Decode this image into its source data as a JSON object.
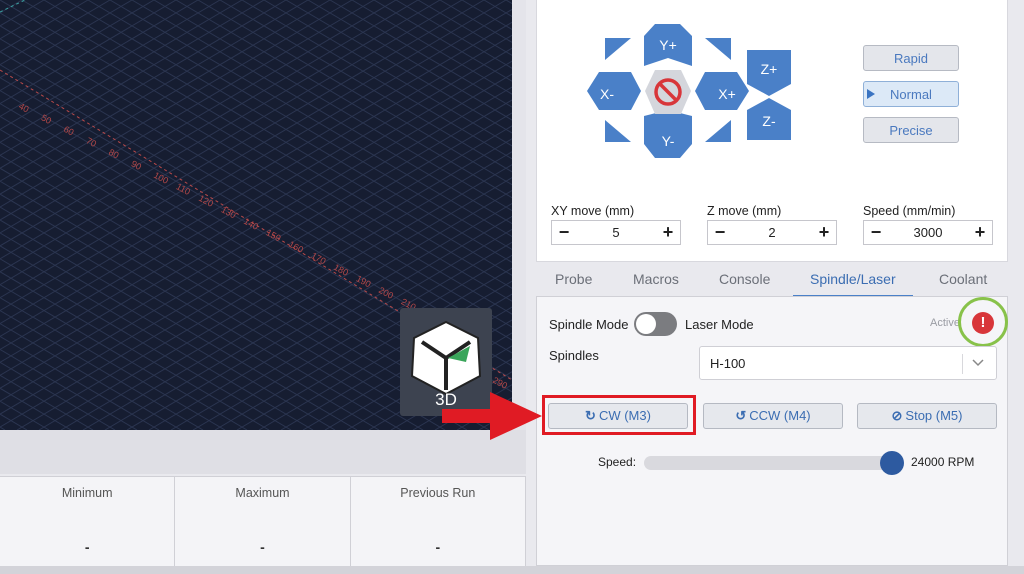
{
  "viewport": {
    "axis_ticks": [
      "40",
      "50",
      "60",
      "70",
      "80",
      "90",
      "100",
      "110",
      "120",
      "130",
      "140",
      "150",
      "160",
      "170",
      "180",
      "190",
      "200",
      "210",
      "290"
    ],
    "view_button_label": "3D"
  },
  "stats": {
    "columns": [
      {
        "title": "Minimum",
        "value": "-"
      },
      {
        "title": "Maximum",
        "value": "-"
      },
      {
        "title": "Previous Run",
        "value": "-"
      }
    ]
  },
  "jog": {
    "xy_buttons": {
      "y_plus": "Y+",
      "y_minus": "Y-",
      "x_plus": "X+",
      "x_minus": "X-"
    },
    "z_buttons": {
      "z_plus": "Z+",
      "z_minus": "Z-"
    },
    "modes": [
      "Rapid",
      "Normal",
      "Precise"
    ],
    "active_mode": "Normal",
    "fields": [
      {
        "label": "XY move (mm)",
        "value": "5"
      },
      {
        "label": "Z move (mm)",
        "value": "2"
      },
      {
        "label": "Speed (mm/min)",
        "value": "3000"
      }
    ],
    "minus": "−",
    "plus": "+"
  },
  "tabs": {
    "items": [
      "Probe",
      "Macros",
      "Console",
      "Spindle/Laser",
      "Coolant"
    ],
    "active": "Spindle/Laser"
  },
  "spindle": {
    "mode_label": "Spindle Mode",
    "laser_label": "Laser Mode",
    "active_label": "Active",
    "alert_glyph": "!",
    "spindles_label": "Spindles",
    "selected_spindle": "H-100",
    "buttons": {
      "cw": "CW (M3)",
      "ccw": "CCW (M4)",
      "stop": "Stop (M5)"
    },
    "speed_label": "Speed:",
    "speed_value": "24000 RPM",
    "speed_fraction": 1.0
  },
  "colors": {
    "accent_blue": "#4a80c8",
    "highlight_red": "#e01b24",
    "alert_ring_green": "#88c24a",
    "alert_red": "#d8363a"
  }
}
